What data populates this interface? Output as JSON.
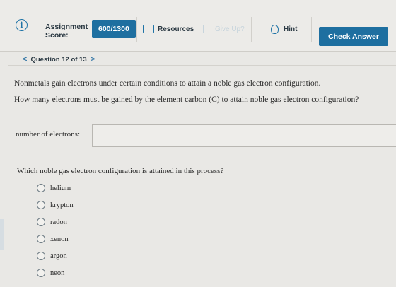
{
  "header": {
    "assignment_label": "Assignment",
    "score_label": "Score:",
    "score_value": "600/1300",
    "resources_label": "Resources",
    "give_up_label": "Give Up?",
    "hint_label": "Hint",
    "check_answer_label": "Check Answer"
  },
  "navigation": {
    "prev_glyph": "<",
    "question_label": "Question 12 of 13",
    "next_glyph": ">"
  },
  "question": {
    "intro": "Nonmetals gain electrons under certain conditions to attain a noble gas electron configuration.",
    "prompt": "How many electrons must be gained by the element carbon (C) to attain noble gas electron configuration?",
    "input_label": "number of electrons:",
    "input_value": "",
    "followup": "Which noble gas electron configuration is attained in this process?",
    "options": [
      "helium",
      "krypton",
      "radon",
      "xenon",
      "argon",
      "neon"
    ]
  },
  "icons": {
    "info": "info-icon",
    "resources": "folder-icon",
    "give_up": "flag-icon",
    "hint": "lightbulb-icon"
  },
  "colors": {
    "accent": "#1e6fa0",
    "background": "#e9e8e5"
  }
}
